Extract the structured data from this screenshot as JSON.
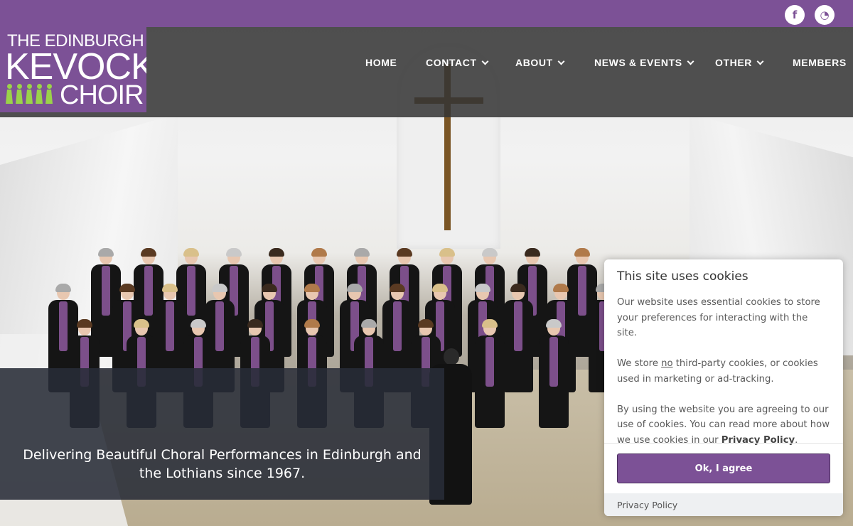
{
  "social": {
    "facebook_icon": "f",
    "rss_icon": "◔"
  },
  "logo": {
    "line1": "THE EDINBURGH",
    "line2": "KEVOCK",
    "line3": "CHOIR"
  },
  "nav": {
    "items": [
      {
        "label": "HOME",
        "dropdown": false
      },
      {
        "label": "CONTACT",
        "dropdown": true
      },
      {
        "label": "ABOUT",
        "dropdown": true
      },
      {
        "label": "NEWS & EVENTS",
        "dropdown": true
      },
      {
        "label": "OTHER",
        "dropdown": true
      },
      {
        "label": "MEMBERS",
        "dropdown": false
      }
    ]
  },
  "hero": {
    "tagline": "Delivering Beautiful Choral Performances in Edinburgh and the Lothians since 1967."
  },
  "cookie": {
    "title": "This site uses cookies",
    "p1": "Our website uses essential cookies to store your preferences for interacting with the site.",
    "p2_before": "We store ",
    "p2_underline": "no",
    "p2_after": " third-party cookies, or cookies used in marketing or ad-tracking.",
    "p3_before": "By using the website you are agreeing to our use of cookies. You can read more about how we use cookies in our ",
    "p3_link": "Privacy Policy",
    "p3_after": ".",
    "agree_label": "Ok, I agree",
    "footer_link": "Privacy Policy"
  },
  "colors": {
    "brand_purple": "#7c5196",
    "nav_overlay": "#343434",
    "logo_green": "#9bd24a"
  }
}
